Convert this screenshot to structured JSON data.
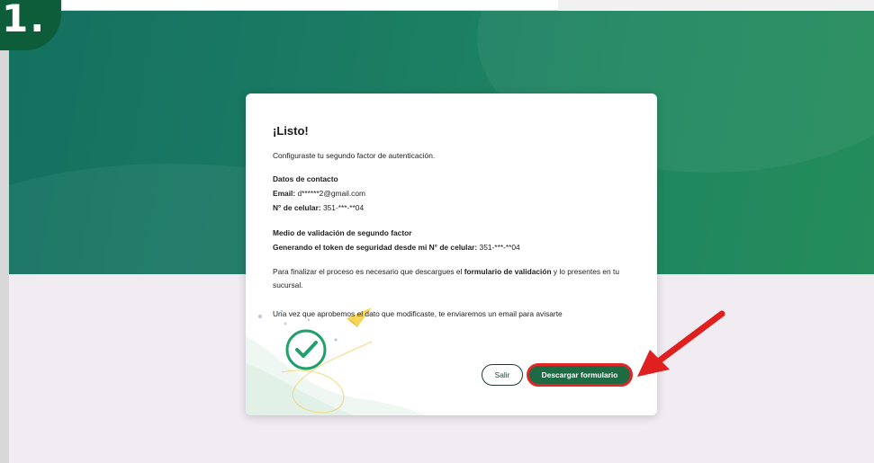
{
  "step_badge": "1.",
  "modal": {
    "title": "¡Listo!",
    "subtitle": "Configuraste tu segundo factor de autenticación.",
    "contact": {
      "heading": "Datos de contacto",
      "email_label": "Email:",
      "email_value": "d******2@gmail.com",
      "phone_label": "N° de celular:",
      "phone_value": "351-***-**04"
    },
    "validation": {
      "heading": "Medio de validación de segundo factor",
      "method_label": "Generando el token de seguridad desde mi N° de celular:",
      "method_value": "351-***-**04"
    },
    "instructions": {
      "prefix": "Para finalizar el proceso es necesario que descargues el ",
      "bold": "formulario de validación",
      "suffix": " y lo presentes en tu sucursal."
    },
    "notice": "Una vez que aprobemos el dato que modificaste, te enviaremos un email para avisarte",
    "buttons": {
      "exit": "Salir",
      "download": "Descargar formulario"
    }
  },
  "colors": {
    "hero_green": "#1a7a63",
    "primary_button": "#1e6a43",
    "highlight_red": "#e22626",
    "check_green": "#20a06a"
  }
}
